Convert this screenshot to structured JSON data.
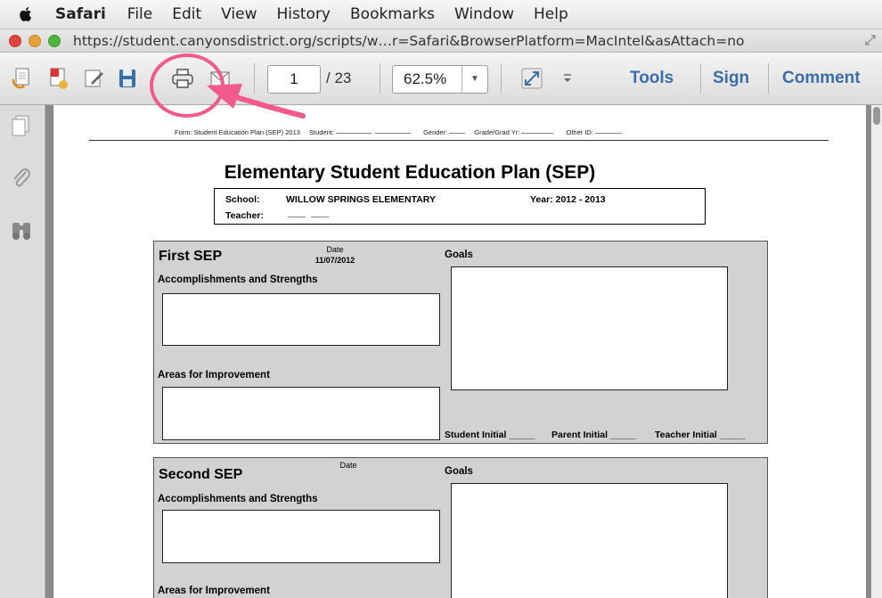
{
  "menubar": {
    "app": "Safari",
    "items": [
      "File",
      "Edit",
      "View",
      "History",
      "Bookmarks",
      "Window",
      "Help"
    ]
  },
  "urlbar": {
    "url": "https://student.canyonsdistrict.org/scripts/w…r=Safari&BrowserPlatform=MacIntel&asAttach=no"
  },
  "toolbar": {
    "page_current": "1",
    "page_total": "/ 23",
    "zoom": "62.5%",
    "tools": "Tools",
    "sign": "Sign",
    "comment": "Comment"
  },
  "document": {
    "header": {
      "form": "Form: Student Education Plan (SEP) 2013",
      "student": "Student:",
      "gender": "Gender:",
      "grade": "Grade/Grad Yr:",
      "other": "Other ID:"
    },
    "title": "Elementary Student Education Plan (SEP)",
    "school_label": "School:",
    "school": "WILLOW SPRINGS ELEMENTARY",
    "year": "Year: 2012 - 2013",
    "teacher_label": "Teacher:",
    "first_sep": {
      "title": "First SEP",
      "date_label": "Date",
      "date": "11/07/2012",
      "goals": "Goals",
      "accomplishments": "Accomplishments and Strengths",
      "improvement": "Areas for Improvement",
      "student_initial": "Student Initial _____",
      "parent_initial": "Parent Initial _____",
      "teacher_initial": "Teacher Initial _____"
    },
    "second_sep": {
      "title": "Second SEP",
      "date_label": "Date",
      "goals": "Goals",
      "accomplishments": "Accomplishments and Strengths",
      "improvement": "Areas for Improvement"
    }
  },
  "colors": {
    "annotation": "#f15a8a",
    "link": "#3b6ea8",
    "section_bg": "#d2d2d2"
  }
}
